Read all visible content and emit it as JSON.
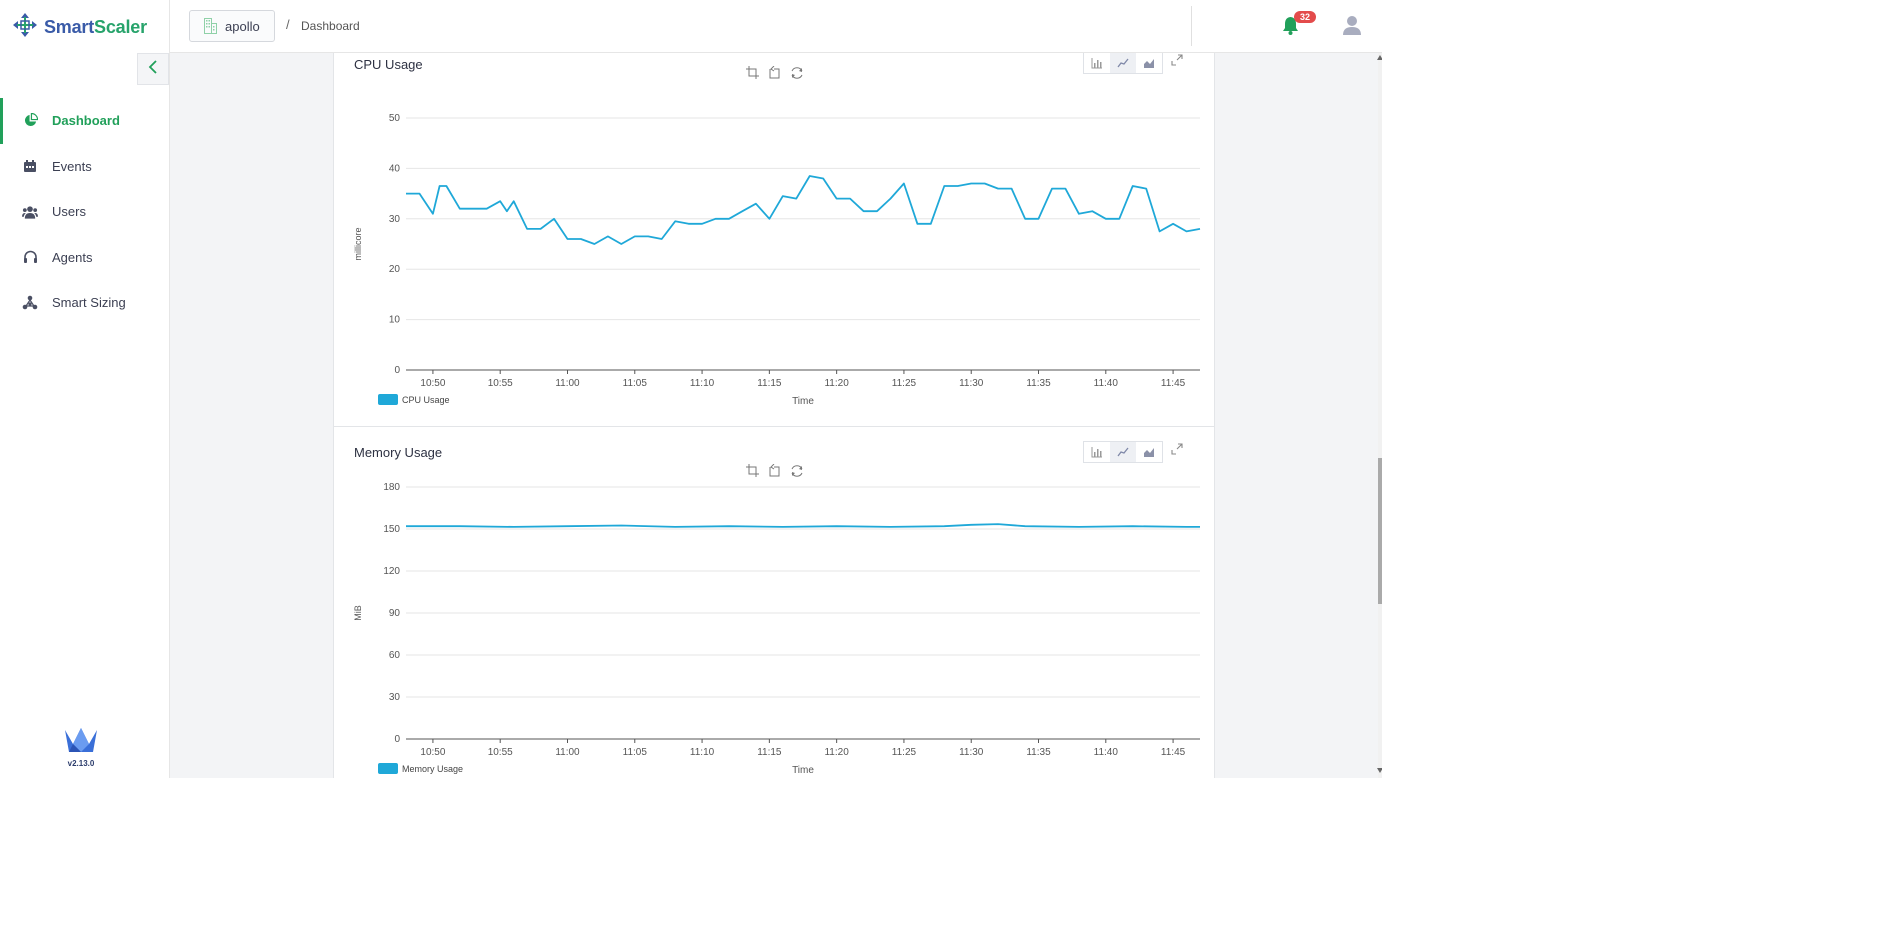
{
  "brand": {
    "name_part1": "Smart",
    "name_part2": "Scaler",
    "version": "v2.13.0"
  },
  "sidebar": {
    "items": [
      {
        "label": "Dashboard",
        "icon": "pie-chart-icon",
        "active": true
      },
      {
        "label": "Events",
        "icon": "calendar-icon",
        "active": false
      },
      {
        "label": "Users",
        "icon": "users-icon",
        "active": false
      },
      {
        "label": "Agents",
        "icon": "headset-icon",
        "active": false
      },
      {
        "label": "Smart Sizing",
        "icon": "sizing-icon",
        "active": false
      }
    ]
  },
  "header": {
    "cluster": "apollo",
    "breadcrumb_sep": "/",
    "breadcrumb": "Dashboard",
    "notifications": "32"
  },
  "colors": {
    "accent": "#21a05a",
    "series": "#1fa8d8",
    "badge": "#e34b4b"
  },
  "chart_data": [
    {
      "type": "line",
      "title": "CPU Usage",
      "xlabel": "Time",
      "ylabel": "millicore",
      "ylim": [
        0,
        50
      ],
      "yticks": [
        "0",
        "10",
        "20",
        "30",
        "40",
        "50"
      ],
      "xticks": [
        "10:50",
        "10:55",
        "11:00",
        "11:05",
        "11:10",
        "11:15",
        "11:20",
        "11:25",
        "11:30",
        "11:35",
        "11:40",
        "11:45"
      ],
      "legend": [
        "CPU Usage"
      ],
      "x_start": "10:48",
      "x_end": "11:47",
      "series": [
        {
          "name": "CPU Usage",
          "x": [
            "10:48",
            "10:49",
            "10:50",
            "10:50.5",
            "10:51",
            "10:52",
            "10:53",
            "10:54",
            "10:55",
            "10:55.5",
            "10:56",
            "10:57",
            "10:58",
            "10:59",
            "11:00",
            "11:01",
            "11:02",
            "11:03",
            "11:04",
            "11:05",
            "11:06",
            "11:07",
            "11:08",
            "11:09",
            "11:10",
            "11:11",
            "11:12",
            "11:13",
            "11:14",
            "11:15",
            "11:16",
            "11:17",
            "11:18",
            "11:19",
            "11:20",
            "11:21",
            "11:22",
            "11:23",
            "11:24",
            "11:25",
            "11:26",
            "11:27",
            "11:28",
            "11:29",
            "11:30",
            "11:31",
            "11:32",
            "11:33",
            "11:34",
            "11:35",
            "11:36",
            "11:37",
            "11:38",
            "11:39",
            "11:40",
            "11:41",
            "11:42",
            "11:43",
            "11:44",
            "11:45",
            "11:46",
            "11:47"
          ],
          "values": [
            35,
            35,
            31,
            36.5,
            36.5,
            32,
            32,
            32,
            33.5,
            31.5,
            33.5,
            28,
            28,
            30,
            26,
            26,
            25,
            26.5,
            25,
            26.5,
            26.5,
            26,
            29.5,
            29,
            29,
            30,
            30,
            31.5,
            33,
            30,
            34.5,
            34,
            38.5,
            38,
            34,
            34,
            31.5,
            31.5,
            34,
            37,
            29,
            29,
            36.5,
            36.5,
            37,
            37,
            36,
            36,
            30,
            30,
            36,
            36,
            31,
            31.5,
            30,
            30,
            36.5,
            36,
            27.5,
            29,
            27.5,
            28
          ]
        }
      ]
    },
    {
      "type": "line",
      "title": "Memory Usage",
      "xlabel": "Time",
      "ylabel": "MiB",
      "ylim": [
        0,
        180
      ],
      "yticks": [
        "0",
        "30",
        "60",
        "90",
        "120",
        "150",
        "180"
      ],
      "xticks": [
        "10:50",
        "10:55",
        "11:00",
        "11:05",
        "11:10",
        "11:15",
        "11:20",
        "11:25",
        "11:30",
        "11:35",
        "11:40",
        "11:45"
      ],
      "legend": [
        "Memory Usage"
      ],
      "x_start": "10:48",
      "x_end": "11:47",
      "series": [
        {
          "name": "Memory Usage",
          "x": [
            "10:48",
            "10:52",
            "10:56",
            "11:00",
            "11:04",
            "11:08",
            "11:12",
            "11:16",
            "11:20",
            "11:24",
            "11:28",
            "11:30",
            "11:32",
            "11:34",
            "11:38",
            "11:42",
            "11:46",
            "11:47"
          ],
          "values": [
            152,
            152,
            151.5,
            152,
            152.5,
            151.5,
            152,
            151.5,
            152,
            151.5,
            152,
            153,
            153.5,
            152,
            151.5,
            152,
            151.5,
            151.5
          ]
        }
      ]
    }
  ]
}
